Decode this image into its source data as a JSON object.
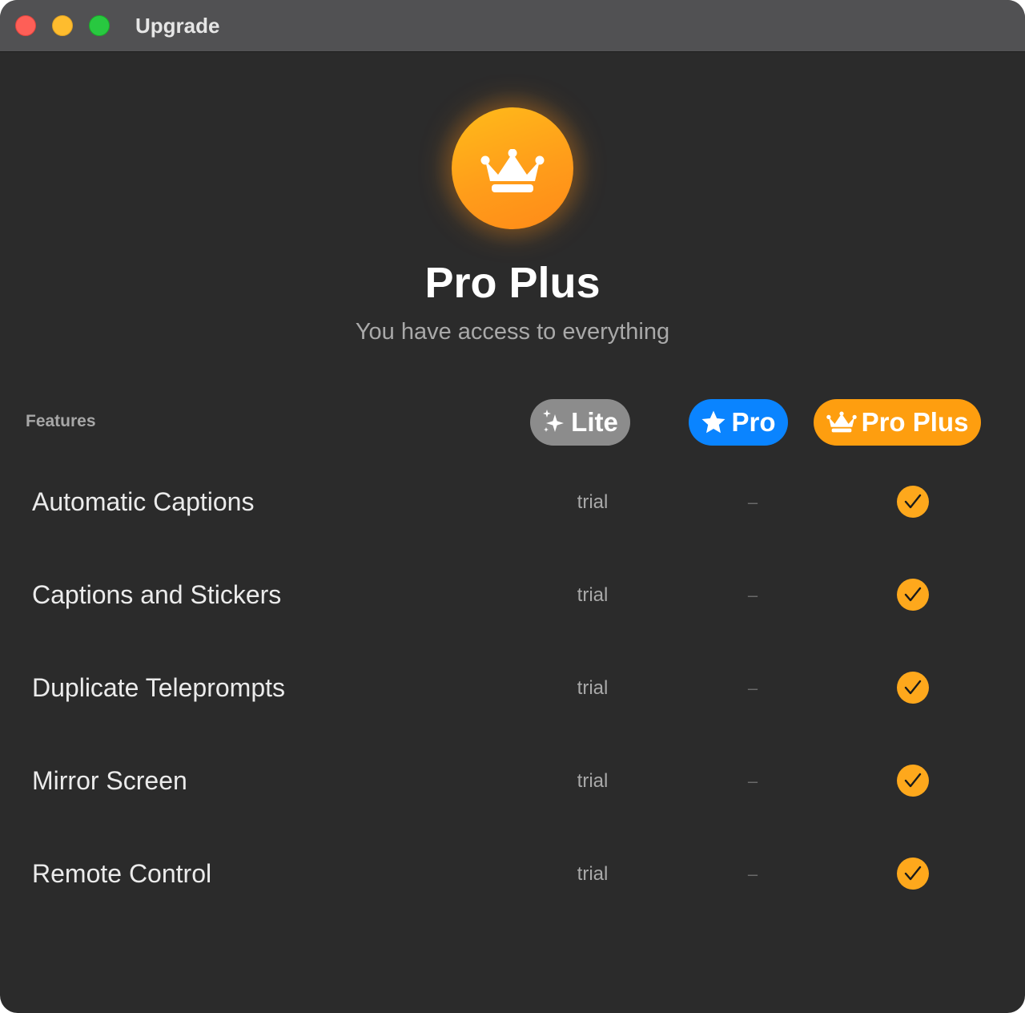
{
  "window": {
    "title": "Upgrade"
  },
  "hero": {
    "icon": "crown-icon",
    "plan_name": "Pro Plus",
    "subtitle": "You have access to everything"
  },
  "table": {
    "features_header": "Features",
    "tiers": [
      {
        "label": "Lite",
        "icon": "sparkles-icon",
        "color": "#8c8c8c"
      },
      {
        "label": "Pro",
        "icon": "star-icon",
        "color": "#0a84ff"
      },
      {
        "label": "Pro Plus",
        "icon": "crown-icon",
        "color": "#fe9e0f"
      }
    ],
    "rows": [
      {
        "feature": "Automatic Captions",
        "lite": "trial",
        "pro": "–",
        "pro_plus": "check-icon"
      },
      {
        "feature": "Captions and Stickers",
        "lite": "trial",
        "pro": "–",
        "pro_plus": "check-icon"
      },
      {
        "feature": "Duplicate Teleprompts",
        "lite": "trial",
        "pro": "–",
        "pro_plus": "check-icon"
      },
      {
        "feature": "Mirror Screen",
        "lite": "trial",
        "pro": "–",
        "pro_plus": "check-icon"
      },
      {
        "feature": "Remote Control",
        "lite": "trial",
        "pro": "–",
        "pro_plus": "check-icon"
      }
    ]
  },
  "colors": {
    "accent": "#fea81c",
    "background": "#2b2b2b"
  }
}
